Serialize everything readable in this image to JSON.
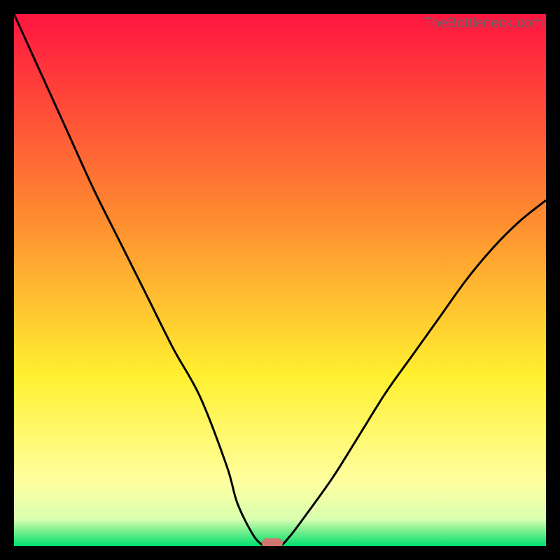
{
  "watermark": "TheBottleneck.com",
  "colors": {
    "red": "#ff1540",
    "orange": "#ff8a30",
    "yellow": "#fff030",
    "paleyellow": "#ffffa0",
    "green": "#00e070",
    "marker": "#d07870",
    "curve": "#000000"
  },
  "chart_data": {
    "type": "line",
    "title": "",
    "xlabel": "",
    "ylabel": "",
    "xlim": [
      0,
      100
    ],
    "ylim": [
      0,
      100
    ],
    "x": [
      0,
      5,
      10,
      15,
      20,
      25,
      30,
      35,
      40,
      42,
      45,
      47,
      48,
      50,
      52,
      55,
      60,
      65,
      70,
      75,
      80,
      85,
      90,
      95,
      100
    ],
    "values": [
      100,
      89,
      78,
      67,
      57,
      47,
      37,
      28,
      15,
      8,
      2,
      0,
      0,
      0,
      2,
      6,
      13,
      21,
      29,
      36,
      43,
      50,
      56,
      61,
      65
    ],
    "marker": {
      "x": 48.5,
      "y": 0.5
    },
    "gradient_stops": [
      {
        "pos": 0,
        "color": "#ff1540"
      },
      {
        "pos": 40,
        "color": "#ff8a30"
      },
      {
        "pos": 70,
        "color": "#fff030"
      },
      {
        "pos": 90,
        "color": "#ffffa0"
      },
      {
        "pos": 97,
        "color": "#c0ff90"
      },
      {
        "pos": 100,
        "color": "#00e070"
      }
    ]
  }
}
